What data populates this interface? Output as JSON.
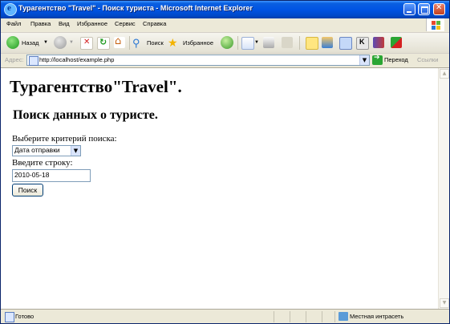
{
  "window": {
    "title": "Турагентство \"Travel\" - Поиск туриста - Microsoft Internet Explorer"
  },
  "menu": {
    "items": [
      "Файл",
      "Правка",
      "Вид",
      "Избранное",
      "Сервис",
      "Справка"
    ]
  },
  "toolbar": {
    "back_label": "Назад",
    "search_label": "Поиск",
    "favorites_label": "Избранное"
  },
  "addressbar": {
    "label": "Адрес:",
    "url": "http://localhost/example.php",
    "go_label": "Переход",
    "links_label": "Ссылки"
  },
  "page": {
    "heading": "Турагентство\"Travel\".",
    "subheading": "Поиск данных о туристе.",
    "criteria_label": "Выберите критерий поиска:",
    "criteria_selected": "Дата отправки",
    "string_label": "Введите строку:",
    "string_value": "2010-05-18",
    "search_button": "Поиск"
  },
  "statusbar": {
    "status": "Готово",
    "zone": "Местная интрасеть"
  }
}
